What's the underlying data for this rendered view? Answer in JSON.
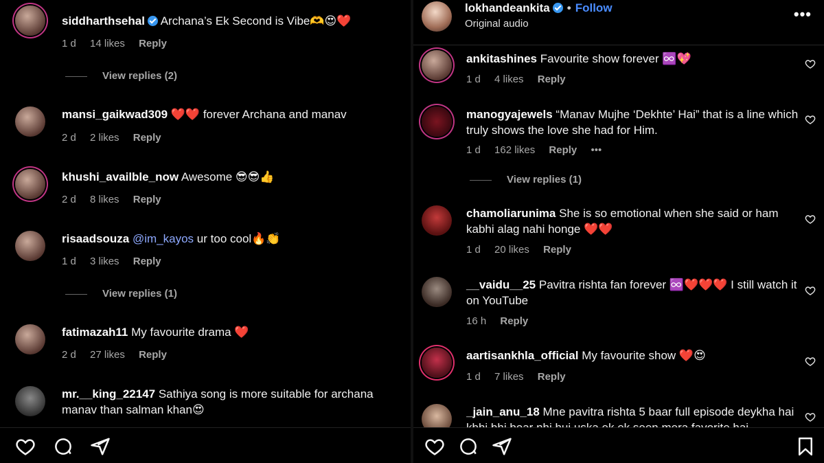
{
  "left": {
    "comments": [
      {
        "user": "siddharthsehal",
        "verified": true,
        "text": "Archana’s Ek Second is Vibe🫶😍❤️",
        "age": "1 d",
        "likes": "14 likes",
        "reply": "Reply"
      },
      {
        "user": "mansi_gaikwad309",
        "text": "❤️❤️ forever Archana and manav",
        "age": "2 d",
        "likes": "2 likes",
        "reply": "Reply"
      },
      {
        "user": "khushi_availble_now",
        "text": "Awesome 😎😎👍",
        "age": "2 d",
        "likes": "8 likes",
        "reply": "Reply"
      },
      {
        "user": "risaadsouza",
        "mention": "@im_kayos",
        "text": "ur too cool🔥👏",
        "age": "1 d",
        "likes": "3 likes",
        "reply": "Reply"
      },
      {
        "user": "fatimazah11",
        "text": "My favourite drama ❤️",
        "age": "2 d",
        "likes": "27 likes",
        "reply": "Reply"
      },
      {
        "user": "mr.__king_22147",
        "text": "Sathiya song is more suitable for archana",
        "text2": "manav than salman khan😍"
      }
    ],
    "view_replies_1": "View replies (2)",
    "view_replies_2": "View replies (1)"
  },
  "right": {
    "header": {
      "username": "lokhandeankita",
      "follow": "Follow",
      "audio": "Original audio",
      "more": "•••"
    },
    "comments": [
      {
        "user": "ankitashines",
        "text": "Favourite show forever ♾️💖",
        "age": "1 d",
        "likes": "4 likes",
        "reply": "Reply"
      },
      {
        "user": "manogyajewels",
        "text": "“Manav Mujhe ‘Dekhte’ Hai” that is a line which",
        "text2": "truly shows the love she had for Him.",
        "age": "1 d",
        "likes": "162 likes",
        "reply": "Reply",
        "more": "•••"
      },
      {
        "user": "chamoliarunima",
        "text": "She is so emotional when she said or ham",
        "text2": "kabhi alag nahi honge ❤️❤️",
        "age": "1 d",
        "likes": "20 likes",
        "reply": "Reply"
      },
      {
        "user": "__vaidu__25",
        "text": "Pavitra rishta fan forever ♾️❤️❤️❤️ I still watch it",
        "text2": "on YouTube",
        "age": "16 h",
        "reply": "Reply"
      },
      {
        "user": "aartisankhla_official",
        "text": "My favourite show ❤️😍",
        "age": "1 d",
        "likes": "7 likes",
        "reply": "Reply"
      },
      {
        "user": "_jain_anu_18",
        "text": "Mne pavitra rishta 5 baar full episode deykha hai",
        "text2": "kbhi bhi boar nhi hui uska ek ek seen mera favorite hai"
      }
    ],
    "view_replies": "View replies (1)"
  },
  "colors": {
    "accent_link": "#4a8cff",
    "mention": "#8ea9ff",
    "muted": "#a8a8a8",
    "verified": "#3897f0",
    "ring": "#c13584"
  },
  "icons": {
    "like": "heart-icon",
    "comment": "comment-bubble-icon",
    "share": "paper-plane-icon",
    "save": "bookmark-icon",
    "comment_like": "heart-outline-icon"
  }
}
